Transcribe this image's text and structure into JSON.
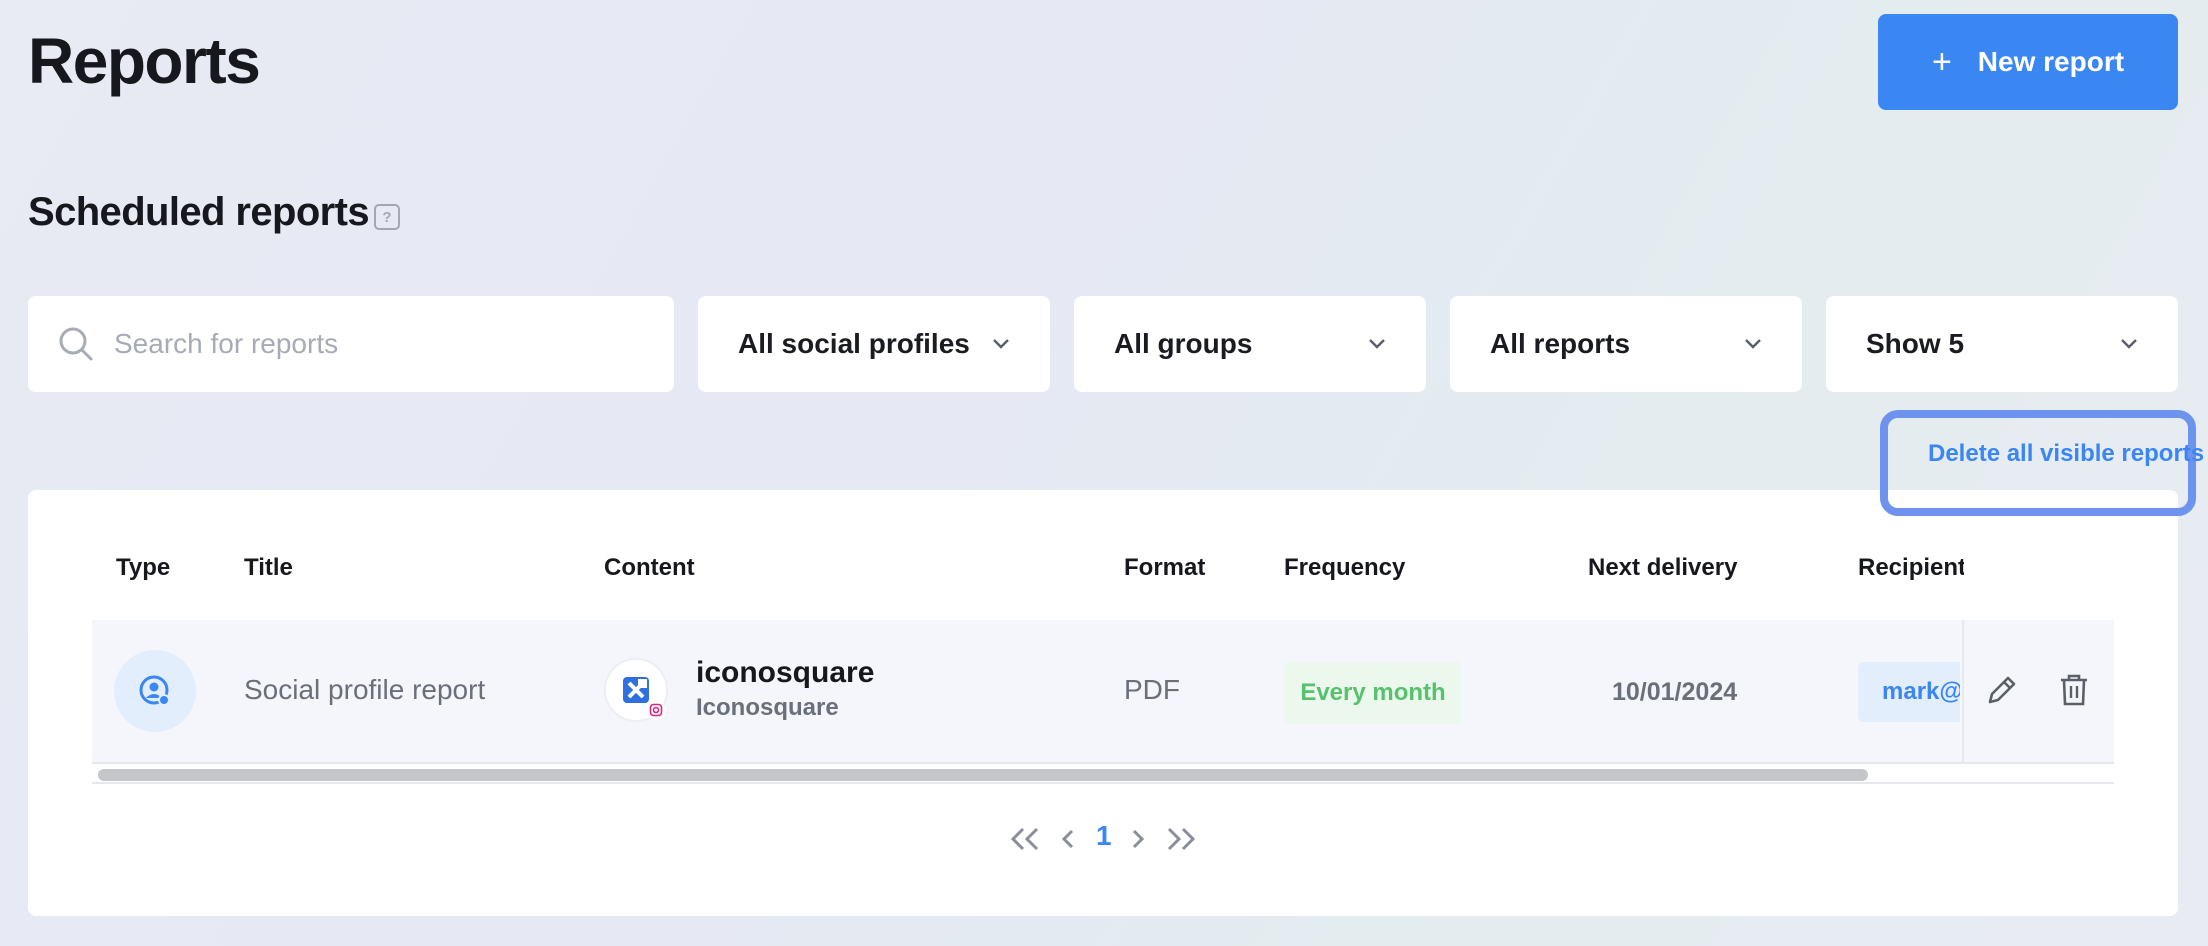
{
  "header": {
    "title": "Reports",
    "new_report_icon": "+",
    "new_report_label": "New report"
  },
  "section": {
    "title": "Scheduled reports",
    "help_icon": "?"
  },
  "filters": {
    "search_placeholder": "Search for reports",
    "social_profiles": "All social profiles",
    "groups": "All groups",
    "reports": "All reports",
    "show": "Show 5"
  },
  "delete_all_label": "Delete all visible reports",
  "table": {
    "columns": {
      "type": "Type",
      "title": "Title",
      "content": "Content",
      "format": "Format",
      "frequency": "Frequency",
      "next_delivery": "Next delivery",
      "recipients": "Recipient("
    },
    "rows": [
      {
        "type_icon": "profile-report-icon",
        "title": "Social profile report",
        "content_name": "iconosquare",
        "content_sub": "Iconosquare",
        "format": "PDF",
        "frequency": "Every month",
        "next_delivery": "10/01/2024",
        "recipient": "mark@ic"
      }
    ]
  },
  "pagination": {
    "current_page": "1"
  },
  "colors": {
    "accent": "#3a86f2",
    "highlight": "#6e93ee",
    "frequency_text": "#57c26c",
    "frequency_bg": "#ecf7ee"
  }
}
